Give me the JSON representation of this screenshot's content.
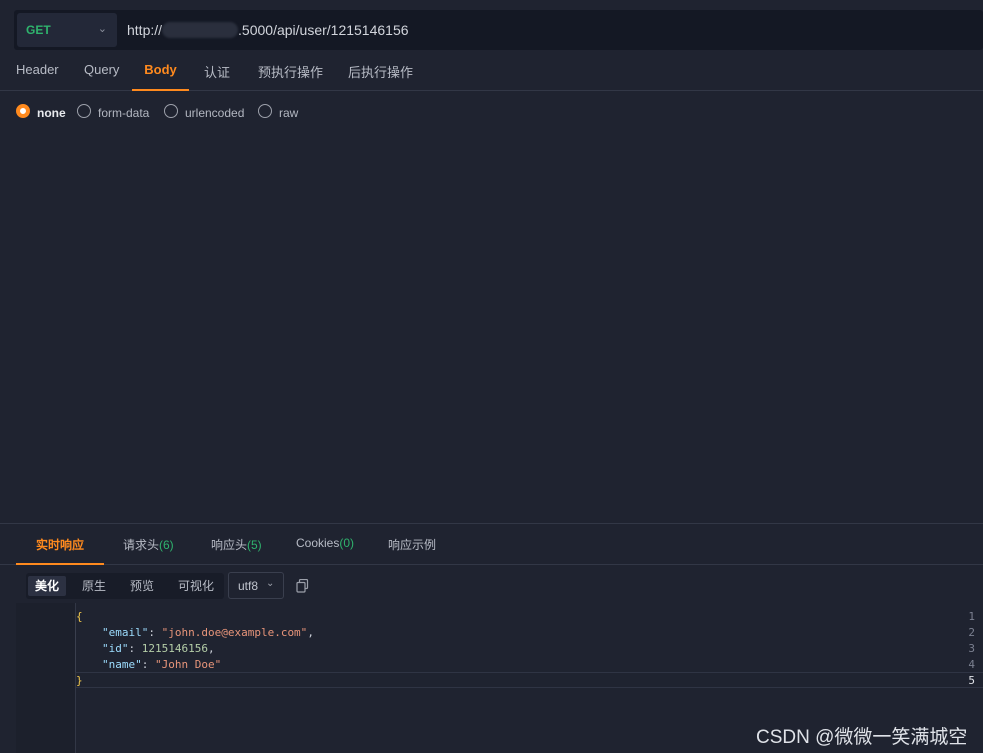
{
  "request": {
    "method": "GET",
    "url_prefix": "http://",
    "url_suffix": ".5000/api/user/1215146156"
  },
  "request_tabs": [
    {
      "label": "Header",
      "active": false
    },
    {
      "label": "Query",
      "active": false
    },
    {
      "label": "Body",
      "active": true
    },
    {
      "label": "认证",
      "active": false
    },
    {
      "label": "预执行操作",
      "active": false
    },
    {
      "label": "后执行操作",
      "active": false
    }
  ],
  "body_types": [
    {
      "label": "none",
      "checked": true
    },
    {
      "label": "form-data",
      "checked": false
    },
    {
      "label": "urlencoded",
      "checked": false
    },
    {
      "label": "raw",
      "checked": false
    }
  ],
  "response_tabs": [
    {
      "label": "实时响应",
      "count": "",
      "active": true
    },
    {
      "label": "请求头",
      "count": "(6)",
      "active": false
    },
    {
      "label": "响应头",
      "count": "(5)",
      "active": false
    },
    {
      "label": "Cookies",
      "count": "(0)",
      "active": false
    },
    {
      "label": "响应示例",
      "count": "",
      "active": false
    }
  ],
  "format_buttons": [
    {
      "label": "美化",
      "active": true
    },
    {
      "label": "原生",
      "active": false
    },
    {
      "label": "预览",
      "active": false
    },
    {
      "label": "可视化",
      "active": false
    }
  ],
  "encoding": "utf8",
  "response_body": {
    "line_numbers": [
      "1",
      "2",
      "3",
      "4",
      "5"
    ],
    "open_brace": "{",
    "close_brace": "}",
    "fields": [
      {
        "key": "\"email\"",
        "value": "\"john.doe@example.com\"",
        "type": "string",
        "trail": ","
      },
      {
        "key": "\"id\"",
        "value": "1215146156",
        "type": "number",
        "trail": ","
      },
      {
        "key": "\"name\"",
        "value": "\"John Doe\"",
        "type": "string",
        "trail": ""
      }
    ]
  },
  "watermark": "CSDN @微微一笑满城空",
  "colors": {
    "accent": "#ff8a1e",
    "method_get": "#2fb36d",
    "background": "#1f2330"
  }
}
